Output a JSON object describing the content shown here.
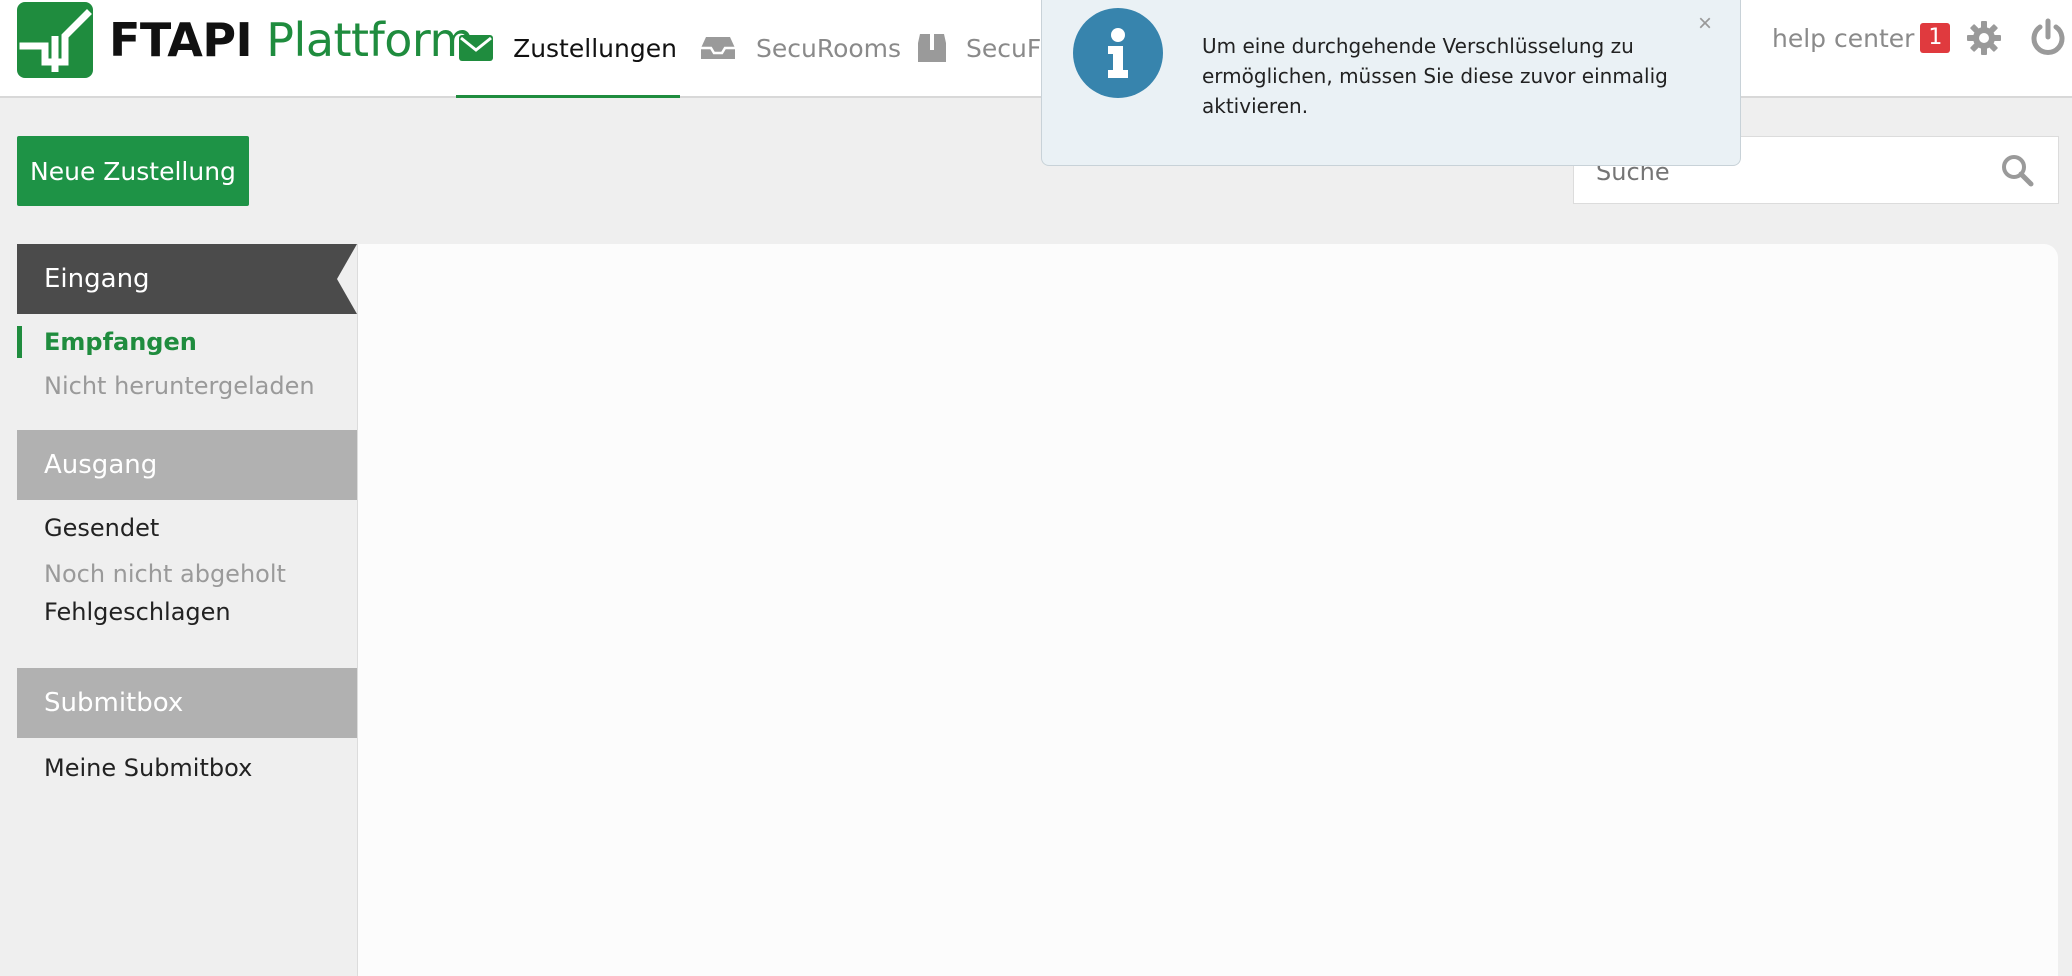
{
  "logo": {
    "brand": "FTAPI",
    "product": "Plattform"
  },
  "nav": {
    "tabs": [
      {
        "label": "Zustellungen",
        "icon": "envelope-icon",
        "active": true
      },
      {
        "label": "SecuRooms",
        "icon": "inbox-tray-icon",
        "active": false
      },
      {
        "label": "SecuFo",
        "icon": "box-icon",
        "active": false
      }
    ],
    "help_label": "help center",
    "help_badge": "1"
  },
  "toolbar": {
    "new_button": "Neue Zustellung",
    "search_placeholder": "Suche"
  },
  "sidebar": {
    "sections": [
      {
        "title": "Eingang",
        "items": [
          "Empfangen",
          "Nicht heruntergeladen"
        ]
      },
      {
        "title": "Ausgang",
        "items": [
          "Gesendet",
          "Noch nicht abgeholt",
          "Fehlgeschlagen"
        ]
      },
      {
        "title": "Submitbox",
        "items": [
          "Meine Submitbox"
        ]
      }
    ]
  },
  "toast": {
    "message": "Um eine durchgehende Verschlüsselung zu ermöglichen, müssen Sie diese zuvor einmalig aktivieren.",
    "close": "×"
  },
  "colors": {
    "accent": "#1f8c3e",
    "button": "#1e9346",
    "badge": "#e03a3e",
    "info": "#3784ad"
  }
}
